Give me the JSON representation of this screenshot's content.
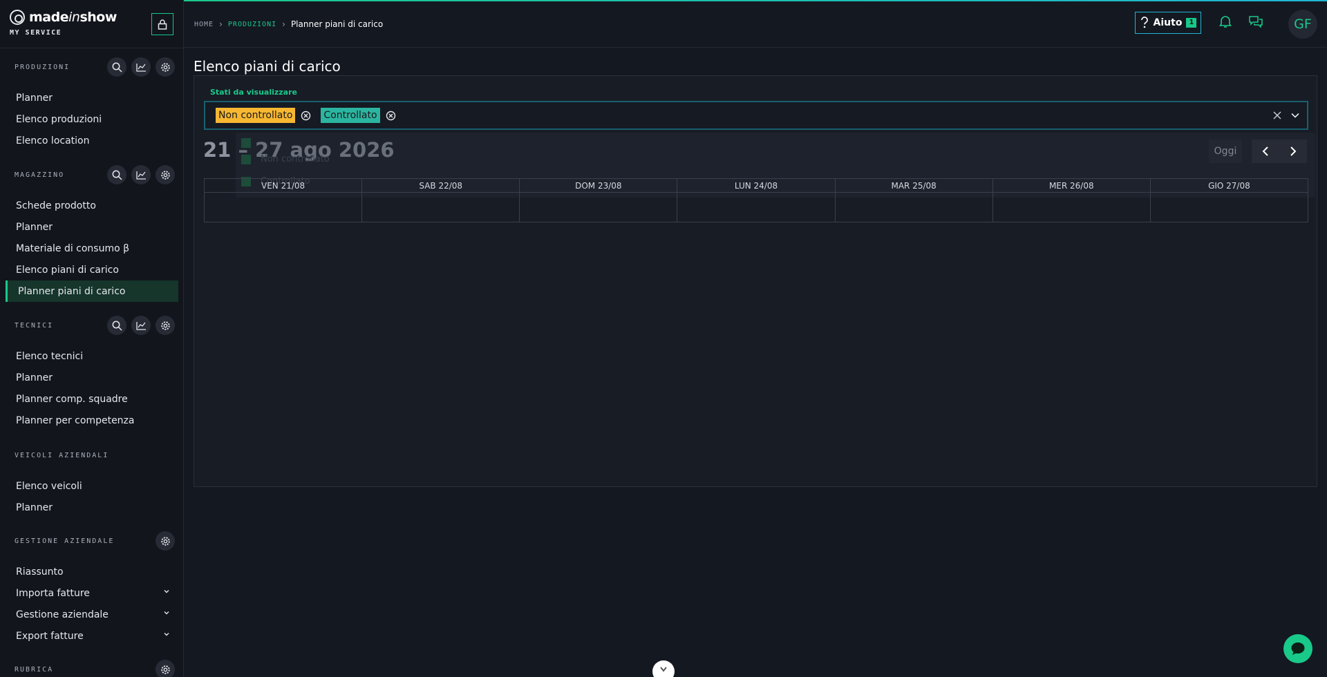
{
  "brand": {
    "name_pre": "made",
    "name_italic": "in",
    "name_post": "show",
    "subtitle": "MY SERVICE"
  },
  "breadcrumb": {
    "home": "HOME",
    "section": "PRODUZIONI",
    "current": "Planner piani di carico"
  },
  "header": {
    "help_label": "Aiuto",
    "help_count": "1",
    "avatar_initials": "GF"
  },
  "sidebar": {
    "sections": [
      {
        "title": "PRODUZIONI",
        "items": [
          "Planner",
          "Elenco produzioni",
          "Elenco location"
        ]
      },
      {
        "title": "MAGAZZINO",
        "items": [
          "Schede prodotto",
          "Planner",
          "Materiale di consumo β",
          "Elenco piani di carico",
          "Planner piani di carico"
        ]
      },
      {
        "title": "TECNICI",
        "items": [
          "Elenco tecnici",
          "Planner",
          "Planner comp. squadre",
          "Planner per competenza"
        ]
      },
      {
        "title": "VEICOLI AZIENDALI",
        "items": [
          "Elenco veicoli",
          "Planner"
        ]
      },
      {
        "title": "GESTIONE AZIENDALE",
        "items": [
          "Riassunto",
          "Importa fatture",
          "Gestione aziendale",
          "Export fatture"
        ]
      },
      {
        "title": "RUBRICA",
        "items": []
      }
    ],
    "active_item": "Planner piani di carico"
  },
  "main": {
    "title": "Elenco piani di carico",
    "filter_label": "Stati da visualizzare",
    "selected_states": [
      "Non controllato",
      "Controllato"
    ],
    "dropdown_options": [
      "Non controllato",
      "Controllato"
    ],
    "date_range": "21 – 27 ago 2026",
    "today_label": "Oggi",
    "days": [
      "VEN 21/08",
      "SAB 22/08",
      "DOM 23/08",
      "LUN 24/08",
      "MAR 25/08",
      "MER 26/08",
      "GIO 27/08"
    ]
  },
  "colors": {
    "accent": "#19c98a",
    "chip_non_controllato": "#f7b731",
    "chip_controllato": "#2bb5a0",
    "background": "#141821"
  }
}
